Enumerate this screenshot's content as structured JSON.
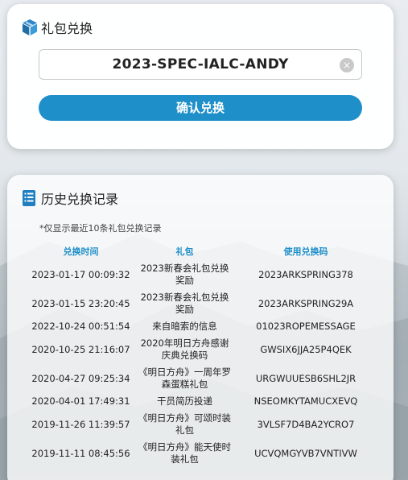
{
  "redeem": {
    "title": "礼包兑换",
    "code_value": "2023-SPEC-IALC-ANDY",
    "clear_icon": "×",
    "confirm_label": "确认兑换"
  },
  "history": {
    "title": "历史兑换记录",
    "note": "*仅显示最近10条礼包兑换记录",
    "columns": [
      "兑换时间",
      "礼包",
      "使用兑换码"
    ],
    "rows": [
      {
        "time": "2023-01-17 00:09:32",
        "gift": "2023新春会礼包兑换奖励",
        "code": "2023ARKSPRING378"
      },
      {
        "time": "2023-01-15 23:20:45",
        "gift": "2023新春会礼包兑换奖励",
        "code": "2023ARKSPRING29A"
      },
      {
        "time": "2022-10-24 00:51:54",
        "gift": "来自暗索的信息",
        "code": "01023ROPEMESSAGE"
      },
      {
        "time": "2020-10-25 21:16:07",
        "gift": "2020年明日方舟感谢庆典兑换码",
        "code": "GWSIX6JJA25P4QEK"
      },
      {
        "time": "2020-04-27 09:25:34",
        "gift": "《明日方舟》一周年罗森蛋糕礼包",
        "code": "URGWUUESB6SHL2JR"
      },
      {
        "time": "2020-04-01 17:49:31",
        "gift": "干员简历投递",
        "code": "NSEOMKYTAMUCXEVQ"
      },
      {
        "time": "2019-11-26 11:39:57",
        "gift": "《明日方舟》可颂时装礼包",
        "code": "3VLSF7D4BA2YCRO7"
      },
      {
        "time": "2019-11-11 08:45:56",
        "gift": "《明日方舟》能天使时装礼包",
        "code": "UCVQMGYVB7VNTIVW"
      }
    ]
  },
  "icons": {
    "redeem_icon": "box-icon",
    "history_icon": "receipt-icon"
  },
  "colors": {
    "accent": "#1f8fc9"
  }
}
